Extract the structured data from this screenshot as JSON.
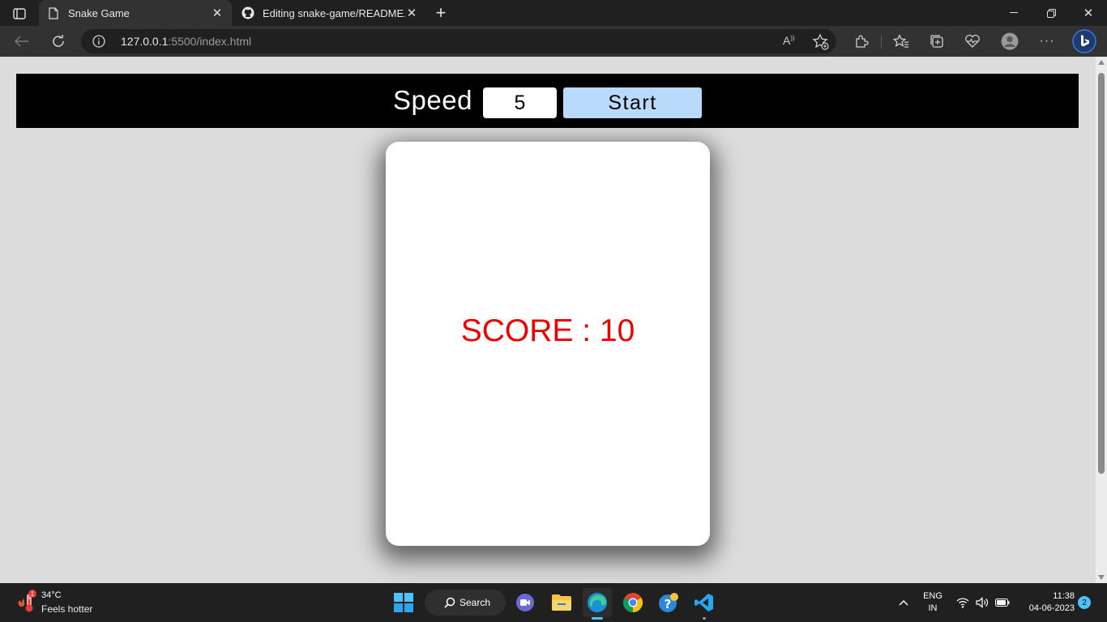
{
  "browser": {
    "tabs": [
      {
        "title": "Snake Game",
        "favicon": "page-icon",
        "active": true
      },
      {
        "title": "Editing snake-game/README.md",
        "favicon": "github-icon",
        "active": false
      }
    ],
    "address": {
      "host": "127.0.0.1",
      "path": ":5500/index.html"
    }
  },
  "game": {
    "speed_label": "Speed",
    "speed_value": "5",
    "start_label": "Start",
    "score_text": "SCORE : 10",
    "score_color": "#ee0000",
    "start_color": "#b9dafb"
  },
  "taskbar": {
    "weather_temp": "34°C",
    "weather_desc": "Feels hotter",
    "weather_badge": "1",
    "search_label": "Search",
    "lang_line1": "ENG",
    "lang_line2": "IN",
    "time": "11:38",
    "date": "04-06-2023",
    "notifications": "2"
  }
}
